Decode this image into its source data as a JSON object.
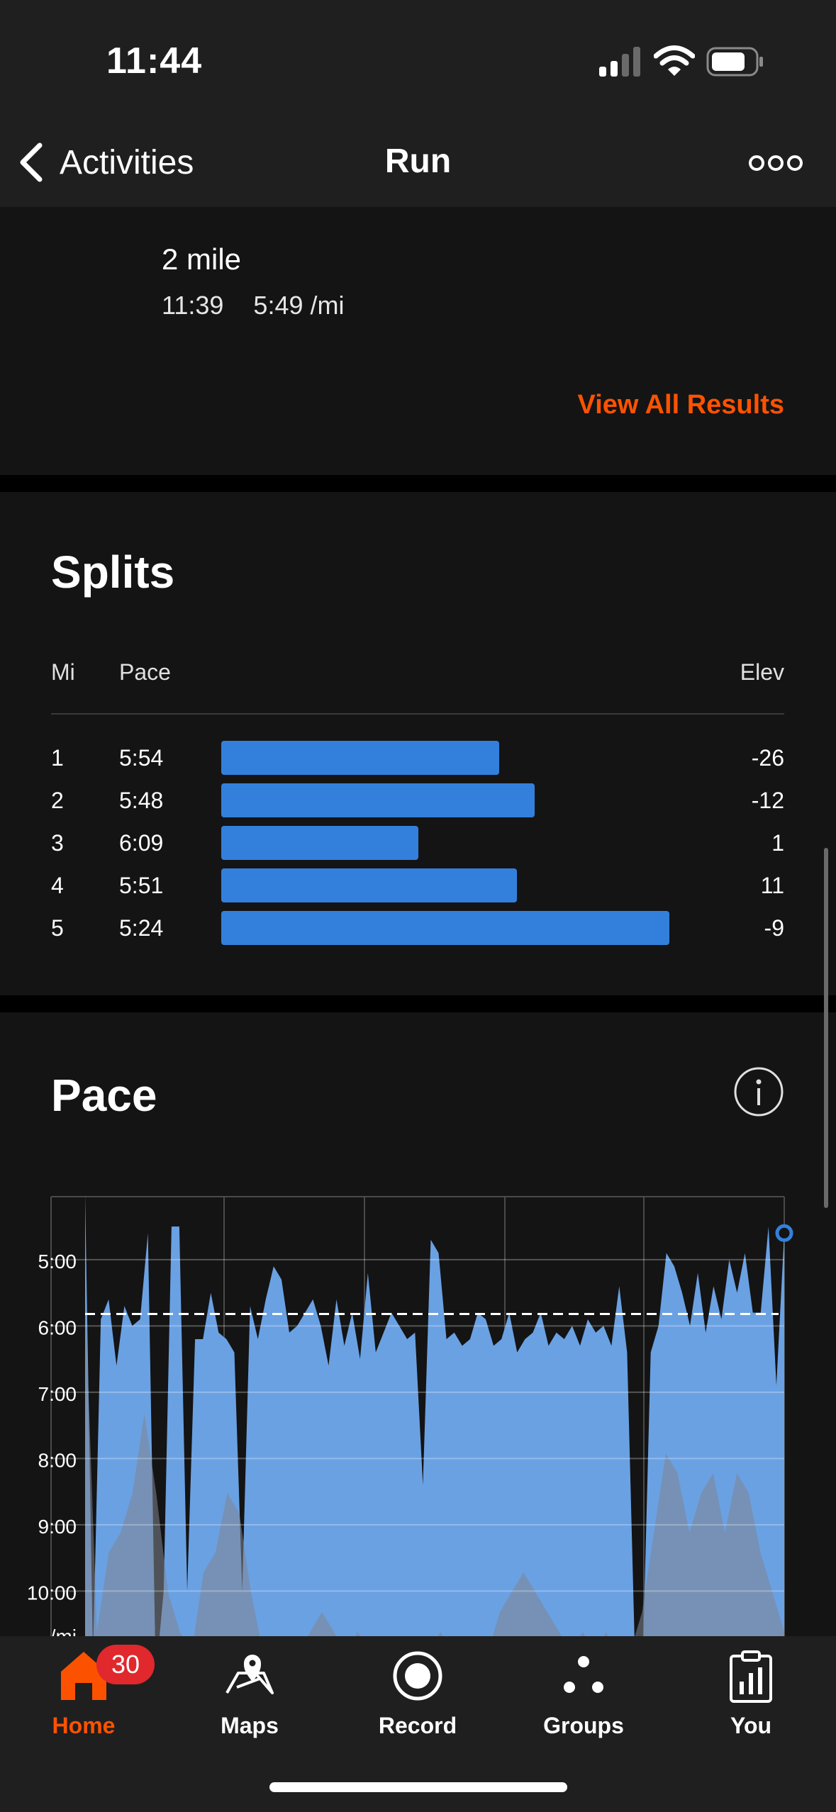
{
  "status_bar": {
    "time": "11:44"
  },
  "nav": {
    "back_label": "Activities",
    "title": "Run",
    "more_icon": "more-dots-icon"
  },
  "results": {
    "name": "2 mile",
    "time": "11:39",
    "pace": "5:49 /mi",
    "view_all_label": "View All Results",
    "accent": "#fc5200"
  },
  "splits": {
    "title": "Splits",
    "headers": {
      "mi": "Mi",
      "pace": "Pace",
      "elev": "Elev"
    },
    "rows": [
      {
        "mi": "1",
        "pace": "5:54",
        "bar_fraction": 0.62,
        "elev": "-26"
      },
      {
        "mi": "2",
        "pace": "5:48",
        "bar_fraction": 0.7,
        "elev": "-12"
      },
      {
        "mi": "3",
        "pace": "6:09",
        "bar_fraction": 0.44,
        "elev": "1"
      },
      {
        "mi": "4",
        "pace": "5:51",
        "bar_fraction": 0.66,
        "elev": "11"
      },
      {
        "mi": "5",
        "pace": "5:24",
        "bar_fraction": 1.0,
        "elev": "-9"
      }
    ],
    "bar_color": "#3380dc"
  },
  "pace": {
    "title": "Pace",
    "info_icon": "info-icon",
    "chart_data": {
      "type": "area",
      "ylabel": "/mi",
      "y_tick_labels": [
        "5:00",
        "6:00",
        "7:00",
        "8:00",
        "9:00",
        "10:00"
      ],
      "y_ticks_min_per_mi": [
        5,
        6,
        7,
        8,
        9,
        10
      ],
      "average_pace_min_per_mi": 5.82,
      "grid": true,
      "pace_series_min_per_mi": [
        4.0,
        11.0,
        5.9,
        5.6,
        6.6,
        5.7,
        6.0,
        5.9,
        4.6,
        11.3,
        10.0,
        4.5,
        4.5,
        10.0,
        6.2,
        6.2,
        5.5,
        6.1,
        6.2,
        6.4,
        10.0,
        5.7,
        6.2,
        5.6,
        5.1,
        5.3,
        6.1,
        6.0,
        5.8,
        5.6,
        6.0,
        6.6,
        5.6,
        6.3,
        5.8,
        6.5,
        5.2,
        6.4,
        6.1,
        5.8,
        6.0,
        6.2,
        6.1,
        8.4,
        4.7,
        4.9,
        6.2,
        6.1,
        6.3,
        6.2,
        5.8,
        5.9,
        6.3,
        6.2,
        5.8,
        6.4,
        6.2,
        6.1,
        5.8,
        6.3,
        6.1,
        6.2,
        6.0,
        6.3,
        5.9,
        6.1,
        6.0,
        6.3,
        5.4,
        6.4,
        11.0,
        11.0,
        6.4,
        6.0,
        4.9,
        5.1,
        5.5,
        6.0,
        5.2,
        6.1,
        5.4,
        5.9,
        5.0,
        5.5,
        4.9,
        5.8,
        5.8,
        4.5,
        6.9,
        4.6
      ],
      "elevation_series_rel": [
        0.95,
        0.1,
        0.3,
        0.35,
        0.45,
        0.65,
        0.45,
        0.2,
        0.1,
        0.05,
        0.25,
        0.3,
        0.45,
        0.4,
        0.2,
        0.05,
        0.0,
        0.0,
        0.05,
        0.1,
        0.15,
        0.1,
        0.05,
        0.1,
        0.05,
        0.0,
        0.05,
        0.05,
        0.0,
        0.05,
        0.1,
        0.05,
        0.0,
        0.0,
        0.05,
        0.15,
        0.2,
        0.25,
        0.2,
        0.15,
        0.1,
        0.05,
        0.1,
        0.05,
        0.1,
        0.0,
        0.05,
        0.15,
        0.35,
        0.55,
        0.5,
        0.35,
        0.45,
        0.5,
        0.35,
        0.5,
        0.45,
        0.3,
        0.2,
        0.1
      ]
    },
    "area_color": "#6aa1e3",
    "elevation_color": "#7f8590"
  },
  "tabs": [
    {
      "label": "Home",
      "icon": "home-icon",
      "active": true
    },
    {
      "label": "Maps",
      "icon": "map-pin-icon",
      "active": false
    },
    {
      "label": "Record",
      "icon": "record-icon",
      "active": false
    },
    {
      "label": "Groups",
      "icon": "groups-icon",
      "active": false
    },
    {
      "label": "You",
      "icon": "clipboard-chart-icon",
      "active": false
    }
  ],
  "badge": {
    "count": "30"
  }
}
